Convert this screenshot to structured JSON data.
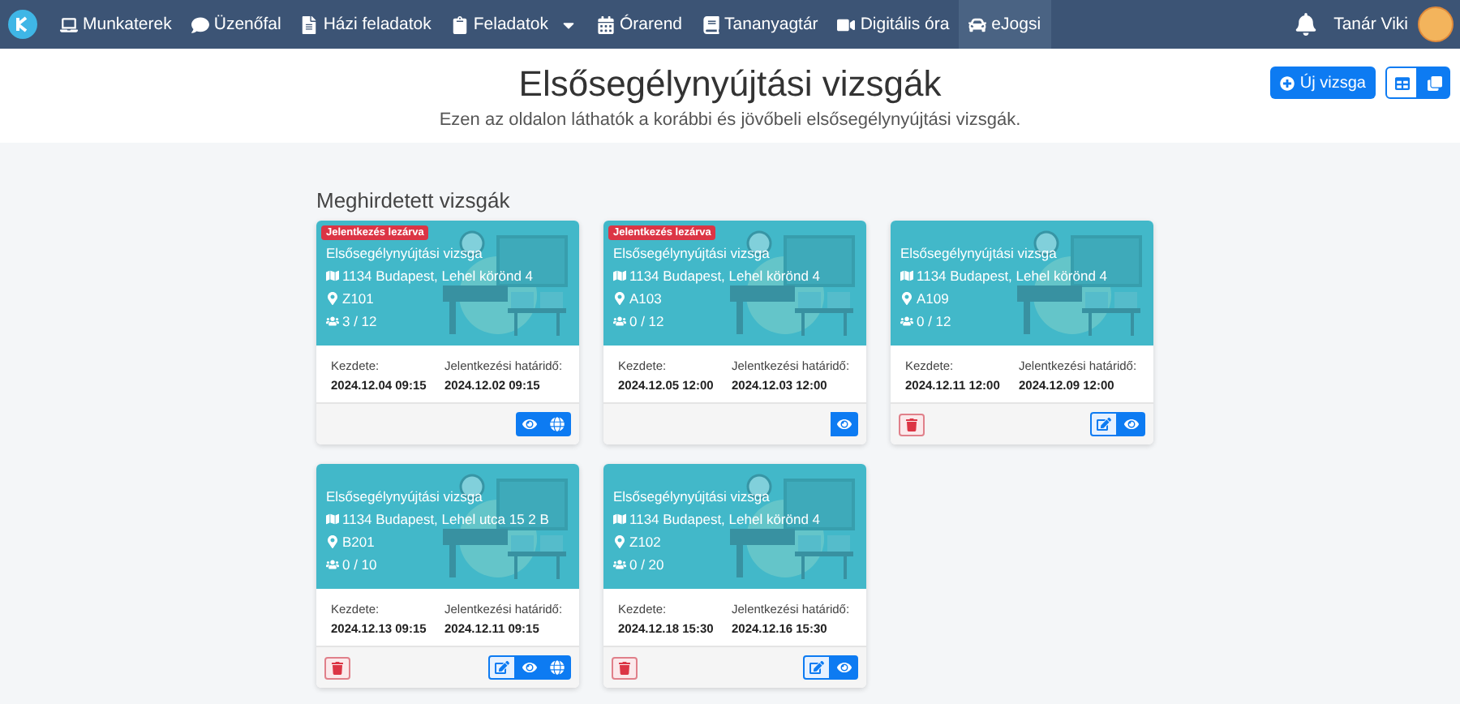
{
  "nav": {
    "items": [
      {
        "kind": "laptop",
        "label": "Munkaterek",
        "selected": false,
        "dropdown": false
      },
      {
        "kind": "chat",
        "label": "Üzenőfal",
        "selected": false,
        "dropdown": false
      },
      {
        "kind": "file",
        "label": "Házi feladatok",
        "selected": false,
        "dropdown": false
      },
      {
        "kind": "clipboard",
        "label": "Feladatok",
        "selected": false,
        "dropdown": true
      },
      {
        "kind": "calendar",
        "label": "Órarend",
        "selected": false,
        "dropdown": false
      },
      {
        "kind": "book",
        "label": "Tananyagtár",
        "selected": false,
        "dropdown": false
      },
      {
        "kind": "video",
        "label": "Digitális óra",
        "selected": false,
        "dropdown": false
      },
      {
        "kind": "car",
        "label": "eJogsi",
        "selected": true,
        "dropdown": false
      }
    ],
    "user": "Tanár Viki"
  },
  "header": {
    "title": "Elsősegélynyújtási vizsgák",
    "subtitle": "Ezen az oldalon láthatók a korábbi és jövőbeli elsősegélynyújtási vizsgák.",
    "new_button": "Új vizsga",
    "views": [
      {
        "kind": "table",
        "selected": false
      },
      {
        "kind": "cards",
        "selected": true
      }
    ]
  },
  "section_title": "Meghirdetett vizsgák",
  "cards": [
    {
      "badge": "Jelentkezés lezárva",
      "title": "Elsősegélynyújtási vizsga",
      "address": "1134 Budapest, Lehel körönd 4",
      "room": "Z101",
      "seats": "3 / 12",
      "start_label": "Kezdete:",
      "start": "2024.12.04 09:15",
      "deadline_label": "Jelentkezési határidő:",
      "deadline": "2024.12.02 09:15",
      "deletable": false,
      "actions": [
        {
          "kind": "view"
        },
        {
          "kind": "globe"
        }
      ]
    },
    {
      "badge": "Jelentkezés lezárva",
      "title": "Elsősegélynyújtási vizsga",
      "address": "1134 Budapest, Lehel körönd 4",
      "room": "A103",
      "seats": "0 / 12",
      "start_label": "Kezdete:",
      "start": "2024.12.05 12:00",
      "deadline_label": "Jelentkezési határidő:",
      "deadline": "2024.12.03 12:00",
      "deletable": false,
      "actions": [
        {
          "kind": "view"
        }
      ]
    },
    {
      "title": "Elsősegélynyújtási vizsga",
      "address": "1134 Budapest, Lehel körönd 4",
      "room": "A109",
      "seats": "0 / 12",
      "start_label": "Kezdete:",
      "start": "2024.12.11 12:00",
      "deadline_label": "Jelentkezési határidő:",
      "deadline": "2024.12.09 12:00",
      "deletable": true,
      "actions": [
        {
          "kind": "edit"
        },
        {
          "kind": "view"
        }
      ]
    },
    {
      "title": "Elsősegélynyújtási vizsga",
      "address": "1134 Budapest, Lehel utca 15 2 B",
      "room": "B201",
      "seats": "0 / 10",
      "start_label": "Kezdete:",
      "start": "2024.12.13 09:15",
      "deadline_label": "Jelentkezési határidő:",
      "deadline": "2024.12.11 09:15",
      "deletable": true,
      "actions": [
        {
          "kind": "edit"
        },
        {
          "kind": "view"
        },
        {
          "kind": "globe"
        }
      ]
    },
    {
      "title": "Elsősegélynyújtási vizsga",
      "address": "1134 Budapest, Lehel körönd 4",
      "room": "Z102",
      "seats": "0 / 20",
      "start_label": "Kezdete:",
      "start": "2024.12.18 15:30",
      "deadline_label": "Jelentkezési határidő:",
      "deadline": "2024.12.16 15:30",
      "deletable": true,
      "actions": [
        {
          "kind": "edit"
        },
        {
          "kind": "view"
        }
      ]
    }
  ]
}
